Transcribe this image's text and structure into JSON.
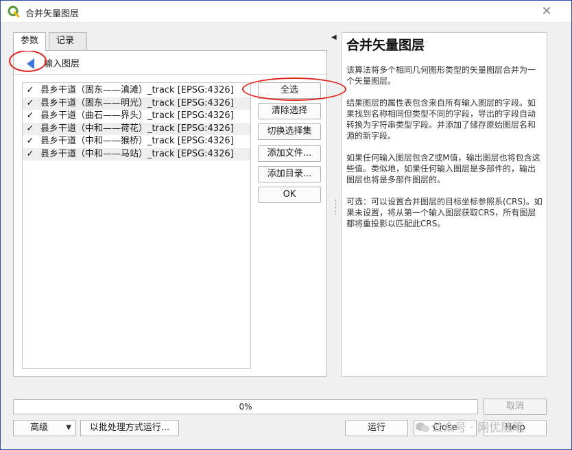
{
  "window": {
    "title": "合并矢量图层",
    "close_label": "✕"
  },
  "tabs": [
    {
      "label": "参数",
      "active": true
    },
    {
      "label": "记录",
      "active": false
    }
  ],
  "section_label": "输入图层",
  "layers": [
    {
      "checked": true,
      "label": "县乡干道（固东——滇滩）_track [EPSG:4326]"
    },
    {
      "checked": true,
      "label": "县乡干道（固东——明光）_track [EPSG:4326]"
    },
    {
      "checked": true,
      "label": "县乡干道（曲石——界头）_track [EPSG:4326]"
    },
    {
      "checked": true,
      "label": "县乡干道（中和——荷花）_track [EPSG:4326]"
    },
    {
      "checked": true,
      "label": "县乡干道（中和——猴桥）_track [EPSG:4326]"
    },
    {
      "checked": true,
      "label": "县乡干道（中和——马站）_track [EPSG:4326]"
    }
  ],
  "side_buttons": {
    "select_all": "全选",
    "clear_selection": "清除选择",
    "toggle_selection": "切换选择集",
    "add_file": "添加文件...",
    "add_directory": "添加目录...",
    "ok": "OK"
  },
  "help": {
    "title": "合并矢量图层",
    "paragraphs": [
      "该算法将多个相同几何图形类型的矢量图层合并为一个矢量图层。",
      "结果图层的属性表包含来自所有输入图层的字段。如果找到名称相同但类型不同的字段，导出的字段自动转换为字符串类型字段。并添加了储存原始图层名和源的新字段。",
      "如果任何输入图层包含Z或M值，输出图层也将包含这些值。类似地，如果任何输入图层是多部件的，输出图层也将是多部件图层的。",
      "可选：可以设置合并图层的目标坐标参照系(CRS)。如果未设置，将从第一个输入图层获取CRS，所有图层都将重投影以匹配此CRS。"
    ]
  },
  "progress": {
    "percent": 0,
    "label": "0%"
  },
  "footer": {
    "cancel": "取消",
    "advanced": "高级",
    "batch": "以批处理方式运行...",
    "run": "运行",
    "close": "Close",
    "help": "Help"
  },
  "watermark": {
    "text": "公众号 · 网优随笔"
  },
  "colors": {
    "accent_blue": "#3a78d8",
    "annotation_red": "#e0211b",
    "qgis_green": "#589632"
  },
  "icons": {
    "app": "qgis-logo-icon",
    "back": "back-arrow-icon",
    "close": "close-icon"
  }
}
